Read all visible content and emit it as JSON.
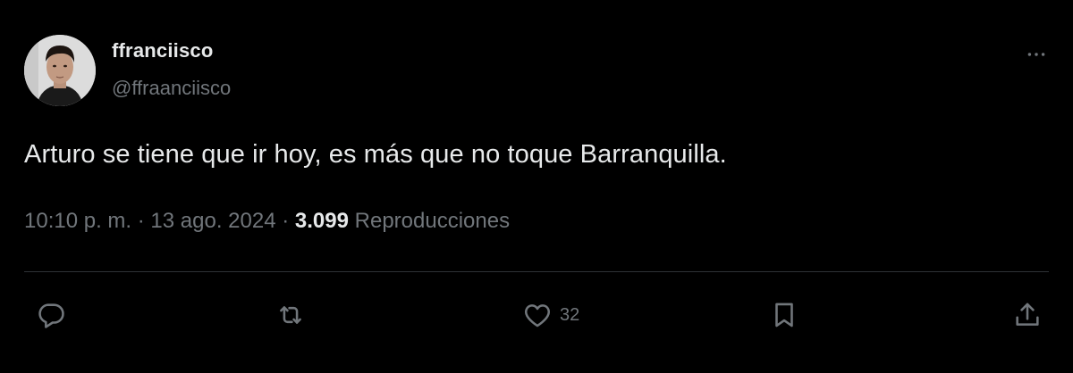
{
  "author": {
    "display_name": "ffranciisco",
    "handle": "@ffraanciisco"
  },
  "tweet": {
    "text": "Arturo se tiene que ir hoy, es más que no toque Barranquilla.",
    "time": "10:10 p. m.",
    "separator": "·",
    "date": "13 ago. 2024",
    "views_count": "3.099",
    "views_label": "Reproducciones"
  },
  "actions": {
    "reply": {
      "icon": "reply-icon"
    },
    "retweet": {
      "icon": "retweet-icon"
    },
    "like": {
      "icon": "heart-icon",
      "count": "32"
    },
    "bookmark": {
      "icon": "bookmark-icon"
    },
    "share": {
      "icon": "share-icon"
    }
  },
  "colors": {
    "background": "#000000",
    "primary_text": "#e7e9ea",
    "secondary_text": "#71767b",
    "divider": "#2f3336"
  }
}
